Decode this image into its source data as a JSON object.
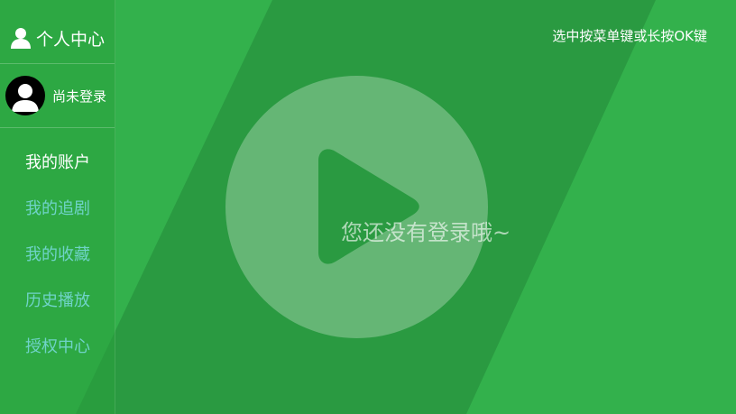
{
  "sidebar": {
    "title": "个人中心",
    "user": {
      "name": "尚未登录"
    },
    "menu": [
      {
        "label": "我的账户",
        "active": true
      },
      {
        "label": "我的追剧",
        "active": false
      },
      {
        "label": "我的收藏",
        "active": false
      },
      {
        "label": "历史播放",
        "active": false
      },
      {
        "label": "授权中心",
        "active": false
      }
    ]
  },
  "header": {
    "hint": "选中按菜单键或长按OK键"
  },
  "main": {
    "empty_message": "您还没有登录哦~"
  },
  "colors": {
    "background": "#33b14c",
    "stripe": "#2a9a41",
    "menu_active": "#ffffff",
    "menu_inactive": "#6fd3c8"
  },
  "icons": {
    "title": "user-icon",
    "avatar": "default-avatar-icon",
    "main": "play-icon"
  }
}
